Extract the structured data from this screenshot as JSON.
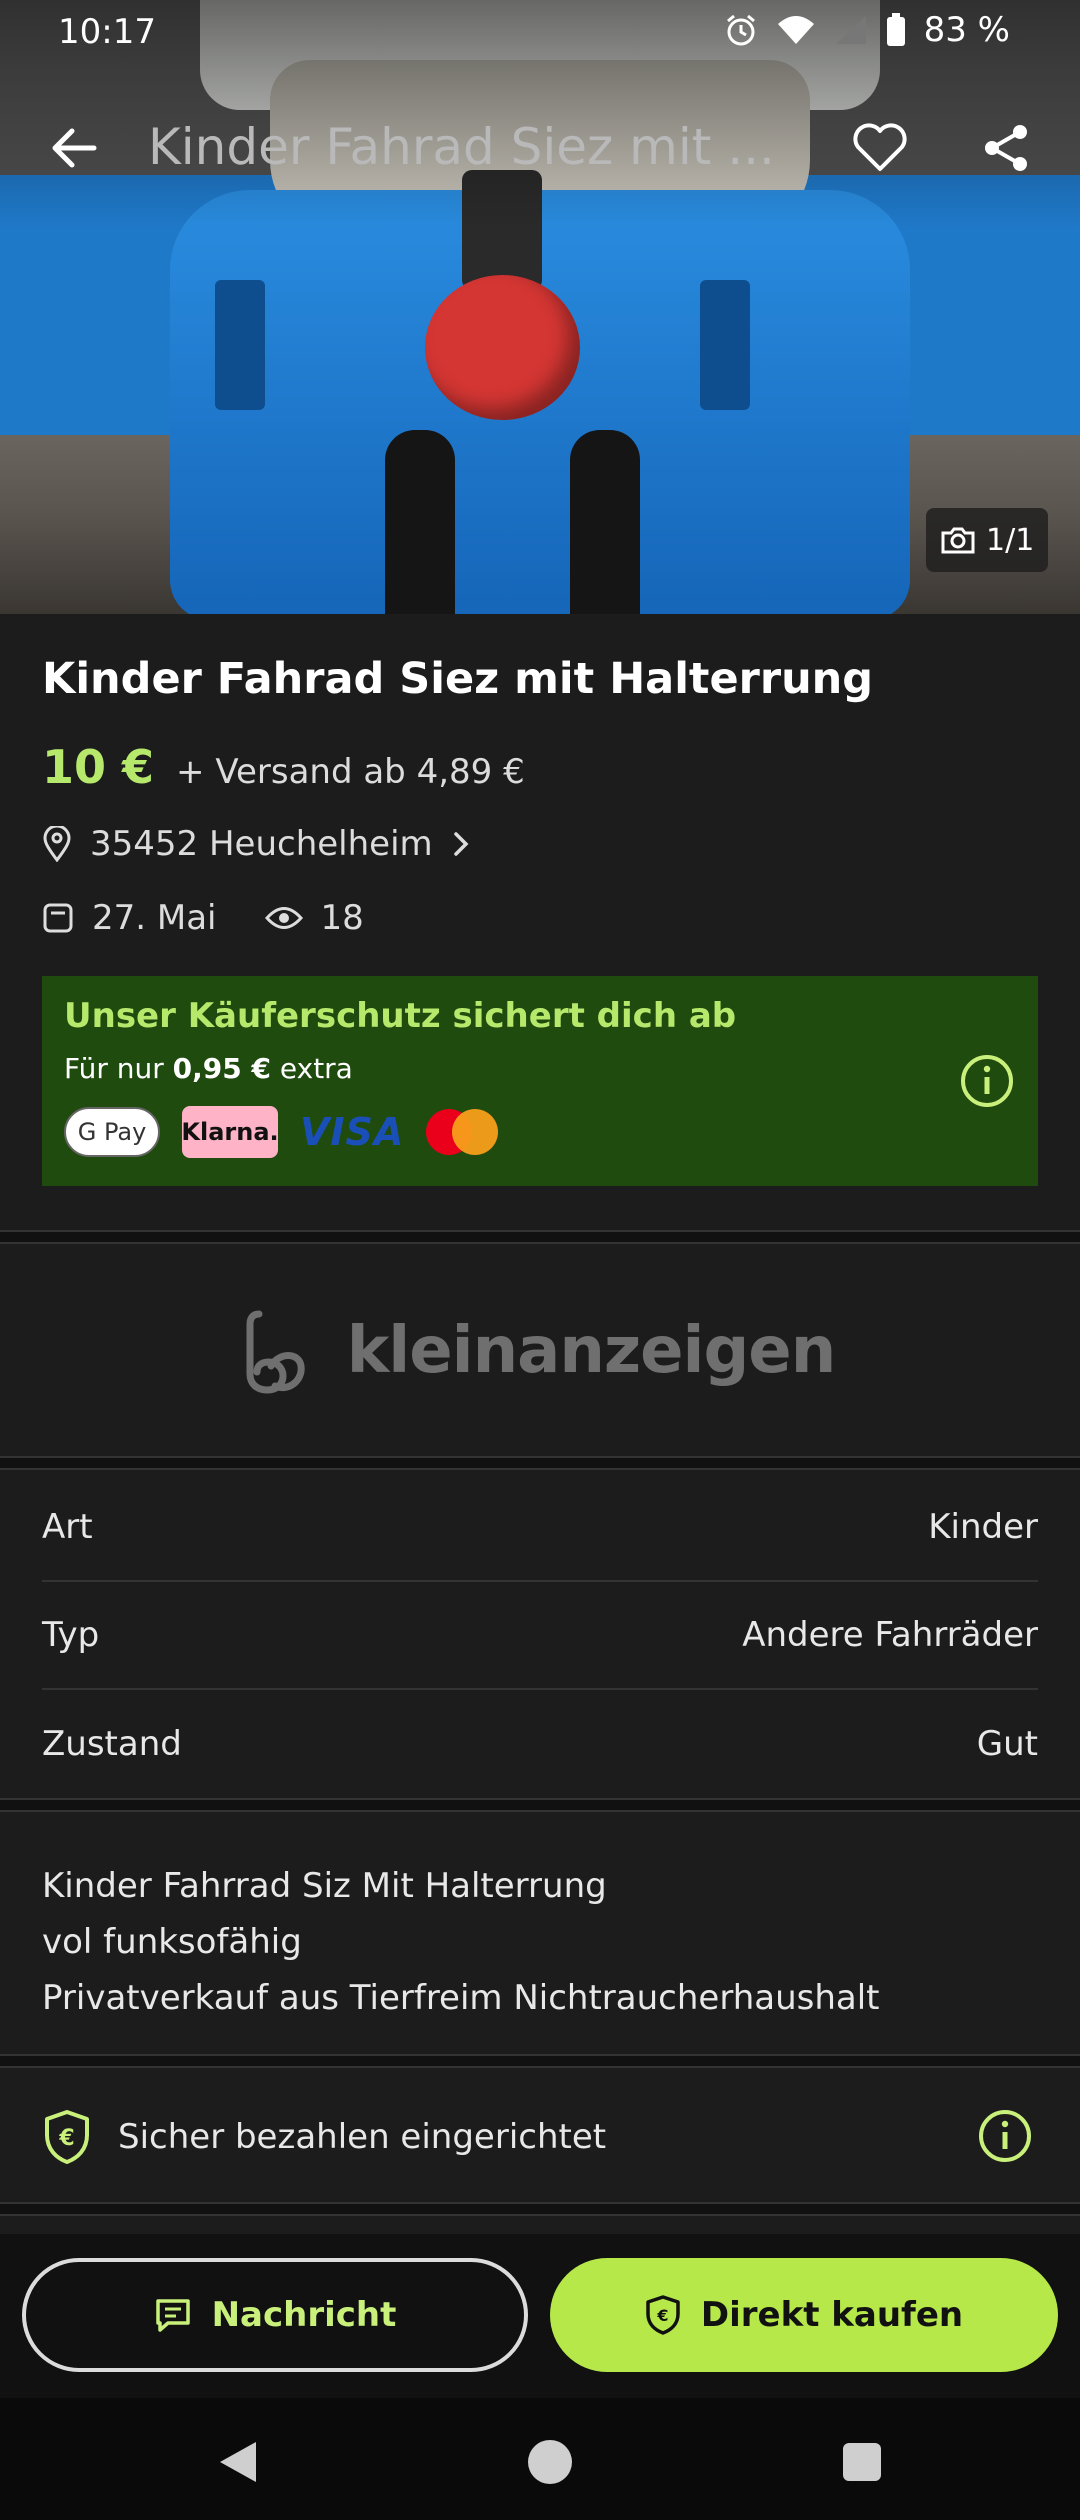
{
  "status_bar": {
    "time": "10:17",
    "battery": "83 %",
    "icons": [
      "alarm-icon",
      "wifi-icon",
      "signal-icon",
      "battery-icon"
    ]
  },
  "topbar": {
    "title": "Kinder Fahrad Siez mit ...",
    "icons": [
      "back-arrow-icon",
      "heart-icon",
      "share-icon"
    ]
  },
  "photo": {
    "counter": "1/1"
  },
  "listing": {
    "title": "Kinder Fahrad Siez mit Halterrung",
    "price": "10 €",
    "shipping": "+ Versand ab 4,89 €",
    "location": "35452 Heuchelheim",
    "date": "27. Mai",
    "views": "18"
  },
  "buyer_protection": {
    "heading": "Unser Käuferschutz sichert dich ab",
    "sub_prefix": "Für nur",
    "sub_amount": "0,95 €",
    "sub_suffix": "extra",
    "payment_methods": {
      "gpay": "G Pay",
      "klarna": "Klarna.",
      "visa": "VISA",
      "mastercard": "mastercard"
    }
  },
  "brand": {
    "name": "kleinanzeigen"
  },
  "attributes": [
    {
      "label": "Art",
      "value": "Kinder"
    },
    {
      "label": "Typ",
      "value": "Andere Fahrräder"
    },
    {
      "label": "Zustand",
      "value": "Gut"
    }
  ],
  "description": {
    "lines": [
      "Kinder Fahrrad Siz Mit Halterrung",
      "vol funksofähig",
      "Privatverkauf aus Tierfreim Nichtraucherhaushalt"
    ]
  },
  "secure_payment": {
    "label": "Sicher bezahlen eingerichtet"
  },
  "actions": {
    "message": "Nachricht",
    "buy": "Direkt kaufen"
  },
  "colors": {
    "accent": "#b6e84a",
    "protect_bg": "#1f4b0e",
    "background": "#1c1c1c"
  }
}
